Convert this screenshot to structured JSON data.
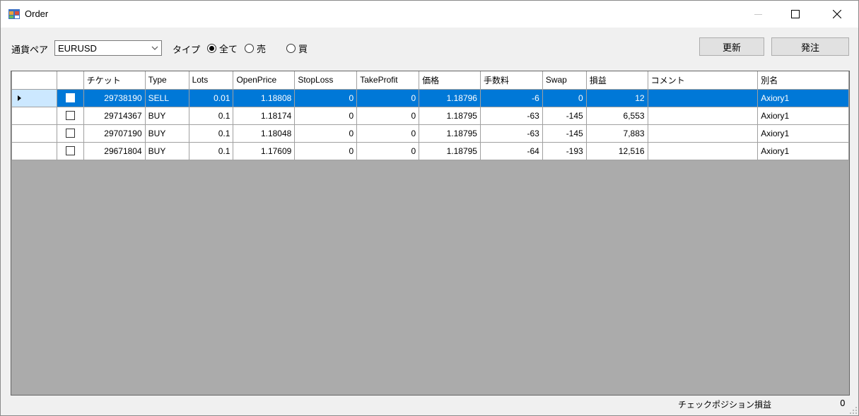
{
  "window": {
    "title": "Order",
    "icon": "app-window-icon"
  },
  "filter": {
    "currency_pair_label": "通貨ペア",
    "currency_pair_value": "EURUSD",
    "type_label": "タイプ",
    "radio_all": "全て",
    "radio_sell": "売",
    "radio_buy": "買",
    "selected_type": "全て"
  },
  "buttons": {
    "refresh": "更新",
    "order": "発注"
  },
  "grid": {
    "columns": [
      "チケット",
      "Type",
      "Lots",
      "OpenPrice",
      "StopLoss",
      "TakeProfit",
      "価格",
      "手数料",
      "Swap",
      "損益",
      "コメント",
      "別名"
    ],
    "rows": [
      {
        "selected": true,
        "checked": false,
        "ticket": "29738190",
        "type": "SELL",
        "lots": "0.01",
        "open_price": "1.18808",
        "stop_loss": "0",
        "take_profit": "0",
        "price": "1.18796",
        "commission": "-6",
        "swap": "0",
        "profit": "12",
        "comment": "",
        "alias": "Axiory1"
      },
      {
        "selected": false,
        "checked": false,
        "ticket": "29714367",
        "type": "BUY",
        "lots": "0.1",
        "open_price": "1.18174",
        "stop_loss": "0",
        "take_profit": "0",
        "price": "1.18795",
        "commission": "-63",
        "swap": "-145",
        "profit": "6,553",
        "comment": "",
        "alias": "Axiory1"
      },
      {
        "selected": false,
        "checked": false,
        "ticket": "29707190",
        "type": "BUY",
        "lots": "0.1",
        "open_price": "1.18048",
        "stop_loss": "0",
        "take_profit": "0",
        "price": "1.18795",
        "commission": "-63",
        "swap": "-145",
        "profit": "7,883",
        "comment": "",
        "alias": "Axiory1"
      },
      {
        "selected": false,
        "checked": false,
        "ticket": "29671804",
        "type": "BUY",
        "lots": "0.1",
        "open_price": "1.17609",
        "stop_loss": "0",
        "take_profit": "0",
        "price": "1.18795",
        "commission": "-64",
        "swap": "-193",
        "profit": "12,516",
        "comment": "",
        "alias": "Axiory1"
      }
    ]
  },
  "footer": {
    "check_position_profit_label": "チェックポジション損益",
    "check_position_profit_value": "0"
  },
  "colors": {
    "selection": "#0078d7",
    "grid_background": "#ababab",
    "window_background": "#f0f0f0"
  }
}
